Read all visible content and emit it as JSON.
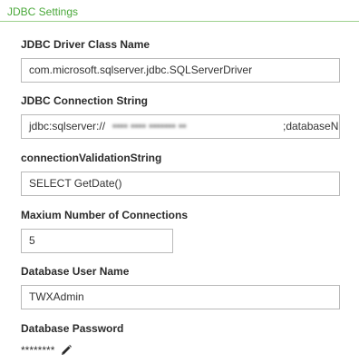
{
  "panel": {
    "title": "JDBC Settings",
    "accent_color": "#4aa83a"
  },
  "fields": {
    "driver_class": {
      "label": "JDBC Driver Class Name",
      "value": "com.microsoft.sqlserver.jdbc.SQLServerDriver"
    },
    "connection_string": {
      "label": "JDBC Connection String",
      "value_prefix": "jdbc:sqlserver://",
      "value_suffix": ";databaseN"
    },
    "validation_string": {
      "label": "connectionValidationString",
      "value": "SELECT GetDate()"
    },
    "max_connections": {
      "label": "Maxium Number of Connections",
      "value": "5"
    },
    "db_user": {
      "label": "Database User Name",
      "value": "TWXAdmin"
    },
    "db_password": {
      "label": "Database Password",
      "masked_value": "********",
      "edit_icon": "pencil-icon"
    }
  }
}
